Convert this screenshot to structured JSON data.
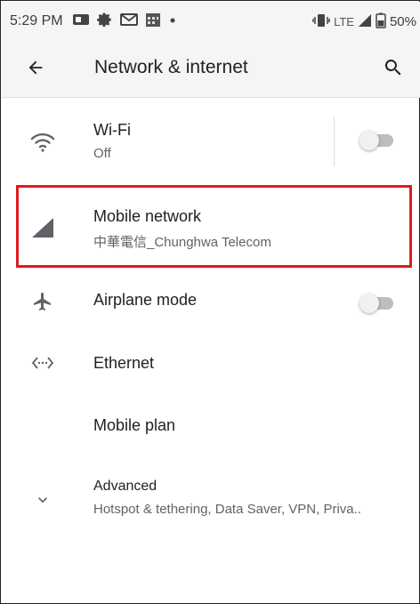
{
  "status_bar": {
    "time": "5:29 PM",
    "network_label": "LTE",
    "battery": "50%",
    "left_icons": [
      "message-icon",
      "gear-icon",
      "gmail-icon",
      "calendar-icon",
      "dot-icon"
    ],
    "right_icons": [
      "vibrate-icon",
      "signal-icon",
      "battery-icon"
    ]
  },
  "app_bar": {
    "title": "Network & internet",
    "back_icon": "arrow-back-icon",
    "search_icon": "search-icon"
  },
  "items": [
    {
      "title": "Wi-Fi",
      "summary": "Off",
      "icon": "wifi-icon",
      "toggle": false
    },
    {
      "title": "Mobile network",
      "summary": "中華電信_Chunghwa Telecom",
      "icon": "cell-signal-icon",
      "highlighted": true
    },
    {
      "title": "Airplane mode",
      "summary": "",
      "icon": "airplane-icon",
      "toggle": false
    },
    {
      "title": "Ethernet",
      "summary": "",
      "icon": "ethernet-icon"
    },
    {
      "title": "Mobile plan",
      "summary": "",
      "icon": ""
    },
    {
      "title": "Advanced",
      "summary": "Hotspot & tethering, Data Saver, VPN, Priva..",
      "icon": "chevron-down-icon"
    }
  ],
  "colors": {
    "highlight": "#e0191f",
    "icon": "#5f6368",
    "toggle_off_track": "#bdbdbd"
  }
}
